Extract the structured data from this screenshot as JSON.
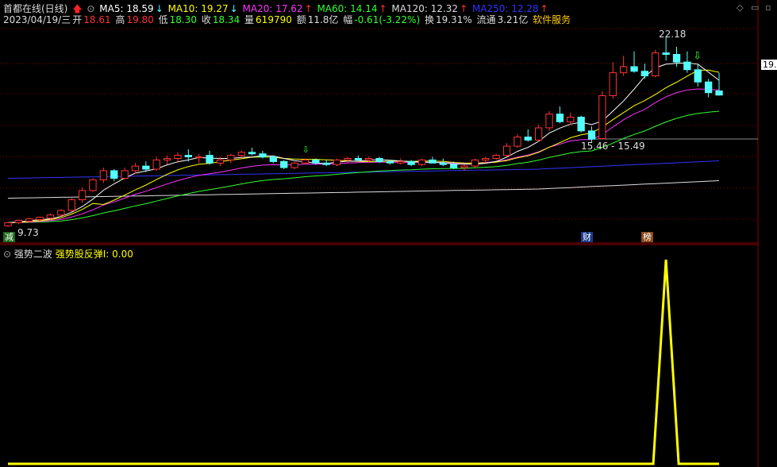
{
  "header": {
    "stock": "首都在线(日线)",
    "ma5": {
      "label": "MA5: 18.59",
      "color": "#ffffff"
    },
    "ma10": {
      "label": "MA10: 19.27",
      "color": "#ffff00"
    },
    "ma20": {
      "label": "MA20: 17.62",
      "color": "#ff33ff"
    },
    "ma60": {
      "label": "MA60: 14.14",
      "color": "#33ff33"
    },
    "ma120": {
      "label": "MA120: 12.32",
      "color": "#dddddd"
    },
    "ma250": {
      "label": "MA250: 12.28",
      "color": "#3333ff"
    }
  },
  "quote": {
    "date": "2023/04/19/三",
    "open_label": "开",
    "open": "18.61",
    "high_label": "高",
    "high": "19.80",
    "low_label": "低",
    "low": "18.30",
    "close_label": "收",
    "close": "18.34",
    "vol_label": "量",
    "vol": "619790",
    "amt_label": "额",
    "amt": "11.8亿",
    "chg_label": "幅",
    "chg": "-0.61(-3.22%)",
    "turn_label": "换",
    "turn": "19.31%",
    "float_label": "流通",
    "float": "3.21亿",
    "sector": "软件服务"
  },
  "annotations": {
    "high_mark": "22.18",
    "gap": "15.46 - 15.49",
    "low_mark": "9.73",
    "price_tag": "19.",
    "tag_jian": "减",
    "tag_cai": "财",
    "tag_bang": "榜"
  },
  "indicator": {
    "name": "强势二波",
    "line_label": "强势股反弹I: 0.00"
  },
  "chart_data": {
    "type": "candlestick",
    "price_range": [
      9.5,
      23
    ],
    "candles": [
      [
        9.8,
        10.0,
        9.73,
        10.0
      ],
      [
        10.0,
        10.2,
        9.9,
        10.15
      ],
      [
        10.1,
        10.3,
        10.0,
        10.25
      ],
      [
        10.2,
        10.4,
        10.1,
        10.35
      ],
      [
        10.3,
        10.6,
        10.2,
        10.5
      ],
      [
        10.5,
        10.9,
        10.4,
        10.8
      ],
      [
        10.8,
        11.6,
        10.7,
        11.5
      ],
      [
        11.5,
        12.3,
        11.3,
        12.1
      ],
      [
        12.1,
        12.9,
        12.0,
        12.8
      ],
      [
        12.8,
        13.6,
        12.6,
        13.4
      ],
      [
        13.4,
        13.5,
        12.7,
        12.9
      ],
      [
        12.9,
        13.6,
        12.8,
        13.4
      ],
      [
        13.4,
        13.9,
        13.2,
        13.7
      ],
      [
        13.7,
        14.0,
        13.3,
        13.5
      ],
      [
        13.5,
        14.3,
        13.4,
        14.1
      ],
      [
        14.1,
        14.4,
        13.8,
        14.2
      ],
      [
        14.2,
        14.6,
        13.9,
        14.4
      ],
      [
        14.4,
        14.8,
        14.0,
        14.3
      ],
      [
        14.3,
        14.5,
        13.9,
        14.3
      ],
      [
        14.4,
        14.7,
        13.8,
        13.9
      ],
      [
        13.9,
        14.3,
        13.7,
        14.1
      ],
      [
        14.1,
        14.5,
        13.9,
        14.4
      ],
      [
        14.4,
        14.7,
        14.2,
        14.6
      ],
      [
        14.6,
        14.9,
        14.4,
        14.5
      ],
      [
        14.5,
        14.7,
        14.2,
        14.3
      ],
      [
        14.3,
        14.4,
        13.9,
        14.0
      ],
      [
        14.0,
        14.1,
        13.5,
        13.6
      ],
      [
        13.6,
        14.0,
        13.5,
        13.9
      ],
      [
        13.9,
        14.2,
        13.8,
        14.1
      ],
      [
        14.1,
        14.2,
        13.8,
        13.9
      ],
      [
        13.9,
        14.1,
        13.7,
        13.8
      ],
      [
        13.8,
        14.2,
        13.7,
        14.1
      ],
      [
        14.1,
        14.3,
        13.9,
        14.2
      ],
      [
        14.2,
        14.4,
        14.0,
        14.1
      ],
      [
        14.1,
        14.3,
        13.9,
        14.2
      ],
      [
        14.2,
        14.3,
        13.9,
        14.0
      ],
      [
        14.0,
        14.1,
        13.8,
        13.9
      ],
      [
        13.9,
        14.2,
        13.8,
        14.0
      ],
      [
        14.0,
        14.1,
        13.7,
        13.8
      ],
      [
        13.8,
        14.2,
        13.7,
        14.1
      ],
      [
        14.1,
        14.3,
        13.9,
        13.9
      ],
      [
        13.9,
        14.2,
        13.7,
        13.8
      ],
      [
        13.8,
        14.0,
        13.5,
        13.6
      ],
      [
        13.6,
        13.8,
        13.4,
        13.7
      ],
      [
        13.7,
        14.2,
        13.6,
        14.1
      ],
      [
        14.1,
        14.3,
        13.9,
        14.2
      ],
      [
        14.2,
        14.5,
        14.1,
        14.4
      ],
      [
        14.4,
        15.2,
        14.3,
        15.0
      ],
      [
        15.0,
        15.8,
        14.9,
        15.6
      ],
      [
        15.6,
        16.1,
        15.3,
        15.4
      ],
      [
        15.4,
        16.4,
        15.3,
        16.2
      ],
      [
        16.2,
        17.3,
        16.0,
        17.1
      ],
      [
        17.1,
        17.6,
        16.5,
        16.6
      ],
      [
        16.6,
        17.2,
        16.4,
        16.9
      ],
      [
        16.9,
        17.0,
        15.9,
        16.0
      ],
      [
        16.0,
        16.3,
        15.2,
        15.46
      ],
      [
        15.49,
        18.6,
        15.49,
        18.3
      ],
      [
        18.3,
        20.5,
        18.1,
        19.8
      ],
      [
        19.8,
        20.9,
        19.6,
        20.2
      ],
      [
        20.2,
        21.2,
        19.8,
        19.9
      ],
      [
        19.9,
        20.4,
        19.4,
        19.6
      ],
      [
        19.6,
        21.3,
        19.5,
        21.1
      ],
      [
        21.1,
        22.18,
        20.6,
        21.0
      ],
      [
        21.0,
        21.5,
        20.2,
        20.5
      ],
      [
        20.5,
        21.2,
        19.8,
        20.0
      ],
      [
        20.0,
        20.4,
        18.9,
        19.2
      ],
      [
        19.2,
        19.4,
        18.2,
        18.5
      ],
      [
        18.61,
        19.8,
        18.3,
        18.34
      ]
    ],
    "indicator_values_note": "强势股反弹I spike to 1 at bar 62",
    "indicator_spike_bar": 62
  },
  "colors": {
    "up": "#ff3333",
    "down": "#54ffff",
    "grid": "#8b0000",
    "ma5": "#ffffff",
    "ma10": "#ffff00",
    "ma20": "#ff33ff",
    "ma60": "#33ff33",
    "ma120": "#dddddd",
    "ma250": "#3333ff",
    "indicator": "#ffff00"
  }
}
